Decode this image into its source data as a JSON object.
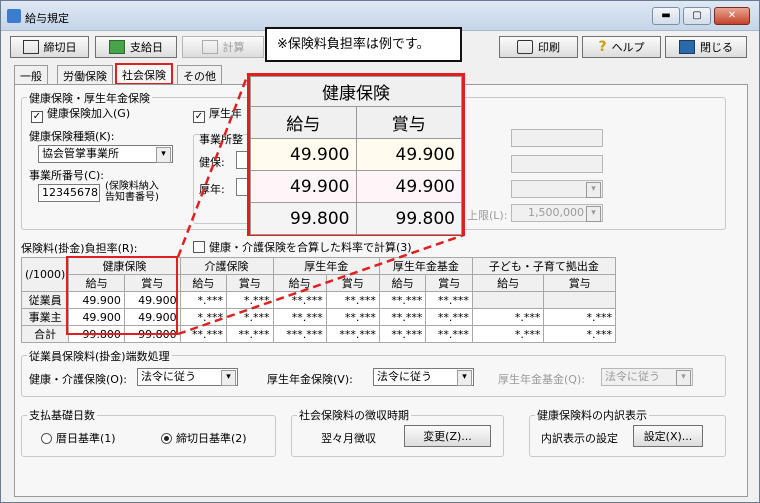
{
  "window": {
    "title": "給与規定"
  },
  "toolbar": {
    "shime": "締切日",
    "shikyu": "支給日",
    "keisan": "計算",
    "print": "印刷",
    "help": "ヘルプ",
    "close": "閉じる"
  },
  "callout": "※保険料負担率は例です。",
  "tabs": [
    "一般",
    "労働保険",
    "社会保険",
    "その他"
  ],
  "health_group": {
    "title": "健康保険・厚生年金保険",
    "check_health": "健康保険加入(G)",
    "check_pension": "厚生年",
    "type_label": "健康保険種類(K):",
    "type_value": "協会管掌事業所",
    "office_no_label": "事業所番号(C):",
    "office_no_value": "12345678",
    "office_no_note1": "(保険料納入",
    "office_no_note2": "告知書番号)",
    "office_label": "事業所整",
    "kenpo_short": "健保:",
    "kounen_short": "厚年:",
    "limit_label": "上限(L):",
    "limit_value": "1,500,000"
  },
  "rate": {
    "label": "保険料(掛金)負担率(R):",
    "combine_check": "健康・介護保険を合算した料率で計算(3)",
    "unit": "(/1000)",
    "groups": [
      "健康保険",
      "介護保険",
      "厚生年金",
      "厚生年金基金",
      "子ども・子育て拠出金"
    ],
    "sub": [
      "給与",
      "賞与"
    ],
    "rows": [
      {
        "label": "従業員",
        "values": [
          "49.900",
          "49.900",
          "*.***",
          "*.***",
          "**.***",
          "**.***",
          "**.***",
          "**.***",
          "",
          ""
        ]
      },
      {
        "label": "事業主",
        "values": [
          "49.900",
          "49.900",
          "*.***",
          "*.***",
          "**.***",
          "**.***",
          "**.***",
          "**.***",
          "*.***",
          "*.***"
        ]
      },
      {
        "label": "合計",
        "values": [
          "99.800",
          "99.800",
          "**.***",
          "**.***",
          "***.***",
          "***.***",
          "**.***",
          "**.***",
          "*.***",
          "*.***"
        ]
      }
    ]
  },
  "zoom": {
    "title": "健康保険",
    "sub": [
      "給与",
      "賞与"
    ],
    "rows": [
      [
        "49.900",
        "49.900"
      ],
      [
        "49.900",
        "49.900"
      ],
      [
        "99.800",
        "99.800"
      ]
    ]
  },
  "rounding": {
    "title": "従業員保険料(掛金)端数処理",
    "health_label": "健康・介護保険(O):",
    "health_value": "法令に従う",
    "pension_label": "厚生年金保険(V):",
    "pension_value": "法令に従う",
    "fund_label": "厚生年金基金(Q):",
    "fund_value": "法令に従う"
  },
  "basis": {
    "title": "支払基礎日数",
    "opt1": "暦日基準(1)",
    "opt2": "締切日基準(2)"
  },
  "timing": {
    "title": "社会保険料の徴収時期",
    "value": "翌々月徴収",
    "button": "変更(Z)..."
  },
  "breakdown": {
    "title": "健康保険料の内訳表示",
    "label": "内訳表示の設定",
    "button": "設定(X)..."
  },
  "colors": {
    "highlight": "#e02020"
  }
}
